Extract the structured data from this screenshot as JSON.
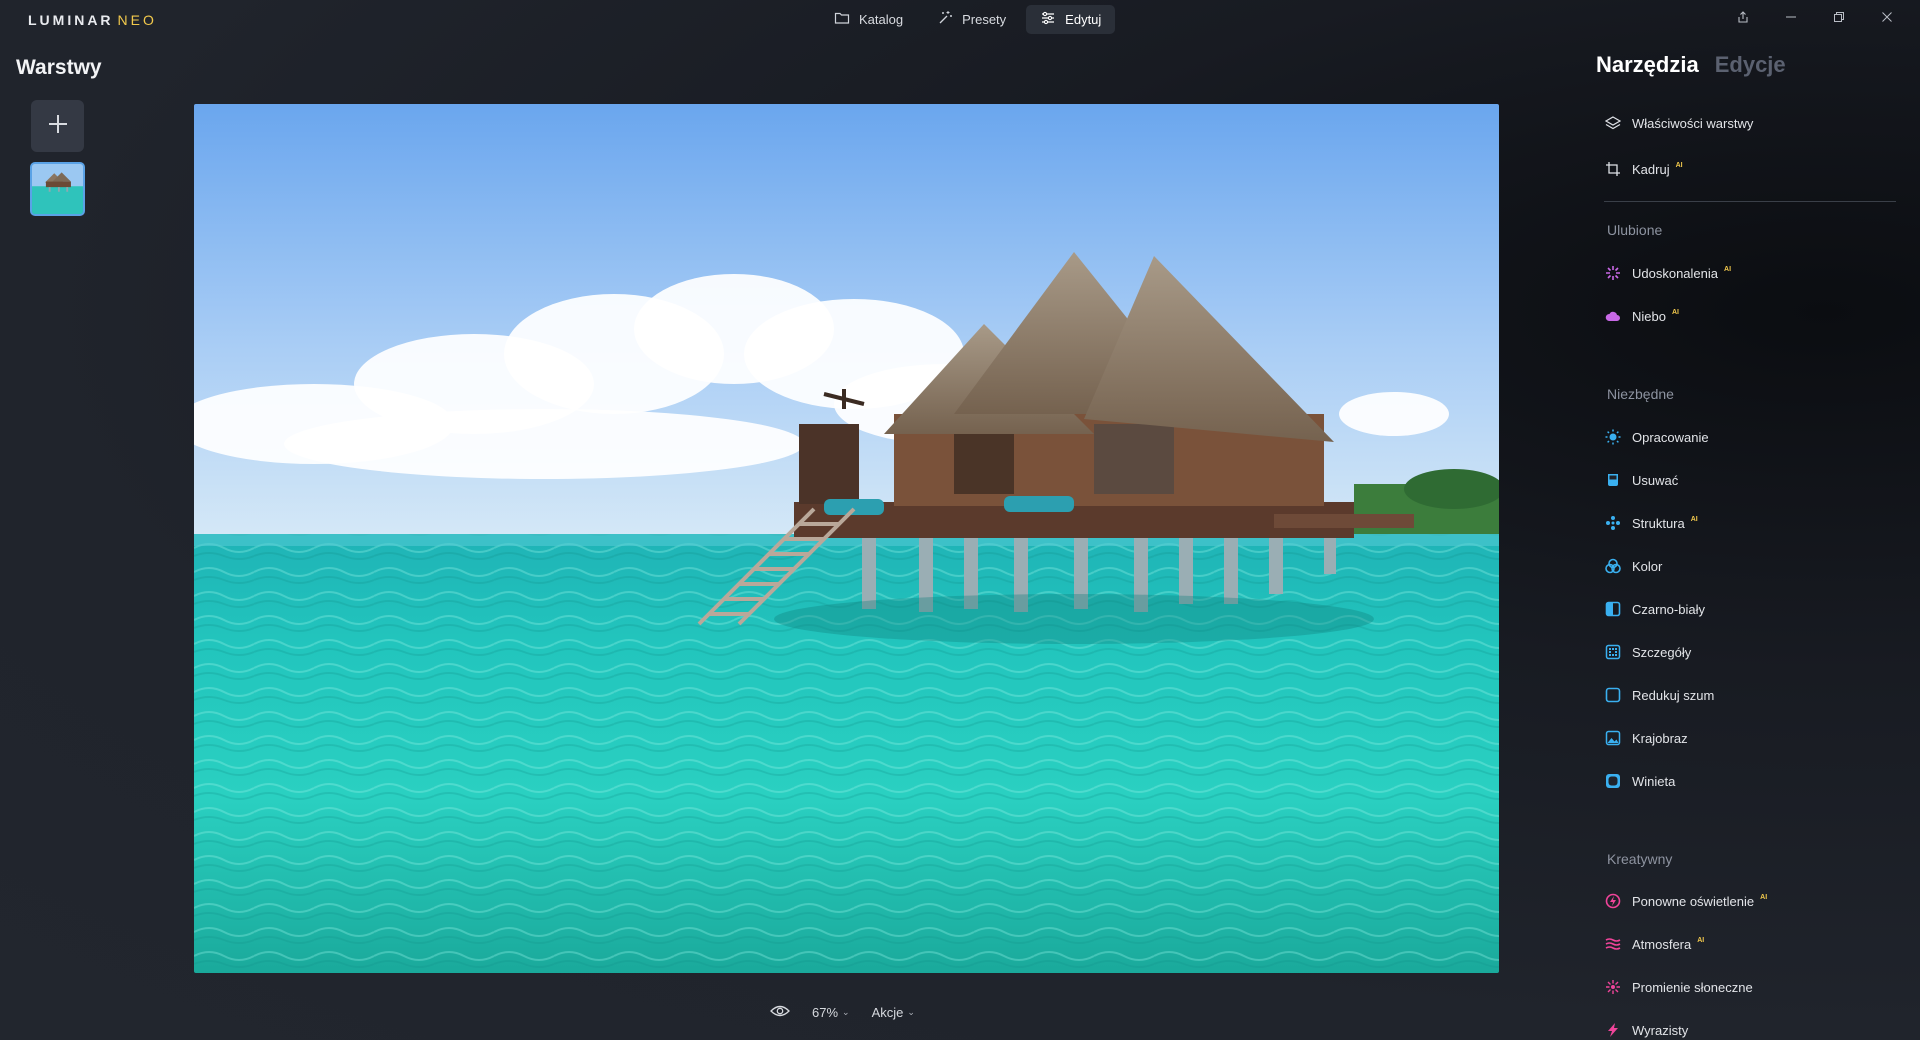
{
  "app": {
    "logo_main": "LUMINAR",
    "logo_sub": "NEO"
  },
  "nav": {
    "katalog": "Katalog",
    "presety": "Presety",
    "edytuj": "Edytuj"
  },
  "layers": {
    "title": "Warstwy"
  },
  "bottom": {
    "zoom": "67%",
    "actions": "Akcje"
  },
  "right": {
    "tab_tools": "Narzędzia",
    "tab_edits": "Edycje",
    "ai_badge": "AI",
    "top_tools": [
      {
        "label": "Właściwości warstwy",
        "icon": "layers-icon"
      },
      {
        "label": "Kadruj",
        "icon": "crop-icon",
        "ai": true
      }
    ],
    "favorites_title": "Ulubione",
    "favorites": [
      {
        "label": "Udoskonalenia",
        "icon": "enhance-icon",
        "ai": true
      },
      {
        "label": "Niebo",
        "icon": "cloud-icon",
        "ai": true
      }
    ],
    "essentials_title": "Niezbędne",
    "essentials": [
      {
        "label": "Opracowanie",
        "icon": "develop-icon"
      },
      {
        "label": "Usuwać",
        "icon": "erase-icon"
      },
      {
        "label": "Struktura",
        "icon": "structure-icon",
        "ai": true
      },
      {
        "label": "Kolor",
        "icon": "color-icon"
      },
      {
        "label": "Czarno-biały",
        "icon": "bw-icon"
      },
      {
        "label": "Szczegóły",
        "icon": "details-icon"
      },
      {
        "label": "Redukuj szum",
        "icon": "denoise-icon"
      },
      {
        "label": "Krajobraz",
        "icon": "landscape-icon"
      },
      {
        "label": "Winieta",
        "icon": "vignette-icon"
      }
    ],
    "creative_title": "Kreatywny",
    "creative": [
      {
        "label": "Ponowne oświetlenie",
        "icon": "relight-icon",
        "ai": true
      },
      {
        "label": "Atmosfera",
        "icon": "atmosphere-icon",
        "ai": true
      },
      {
        "label": "Promienie słoneczne",
        "icon": "sunrays-icon"
      },
      {
        "label": "Wyrazisty",
        "icon": "dramatic-icon"
      }
    ]
  },
  "colors": {
    "accent": "#5aa2e6",
    "ai_badge": "#f2c94c"
  }
}
